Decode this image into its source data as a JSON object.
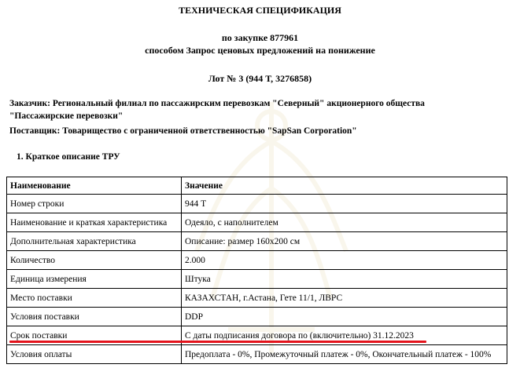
{
  "doc": {
    "title": "ТЕХНИЧЕСКАЯ СПЕЦИФИКАЦИЯ",
    "subtitle1": "по закупке 877961",
    "subtitle2": "способом Запрос ценовых предложений на понижение",
    "lot": "Лот № 3 (944 Т, 3276858)",
    "customer_line1": "Заказчик: Региональный филиал по пассажирским перевозкам \"Северный\" акционерного общества",
    "customer_line2": "\"Пассажирские перевозки\"",
    "supplier": "Поставщик: Товарищество с ограниченной ответственностью \"SapSan Corporation\"",
    "section_title": "1. Краткое описание ТРУ"
  },
  "table": {
    "headers": [
      "Наименование",
      "Значение"
    ],
    "rows": [
      [
        "Номер строки",
        "944 Т"
      ],
      [
        "Наименование и краткая характеристика",
        "Одеяло, с наполнителем"
      ],
      [
        "Дополнительная характеристика",
        "Описание: размер 160х200 см"
      ],
      [
        "Количество",
        "2.000"
      ],
      [
        "Единица измерения",
        "Штука"
      ],
      [
        "Место поставки",
        "КАЗАХСТАН, г.Астана, Гете 11/1, ЛВРС"
      ],
      [
        "Условия поставки",
        "DDP"
      ],
      [
        "Срок поставки",
        "С даты подписания договора по (включительно) 31.12.2023"
      ],
      [
        "Условия оплаты",
        "Предоплата - 0%, Промежуточный платеж - 0%, Окончательный платеж - 100%"
      ]
    ]
  },
  "colors": {
    "highlight_underline": "#e3131c",
    "watermark": "#b8860b"
  }
}
